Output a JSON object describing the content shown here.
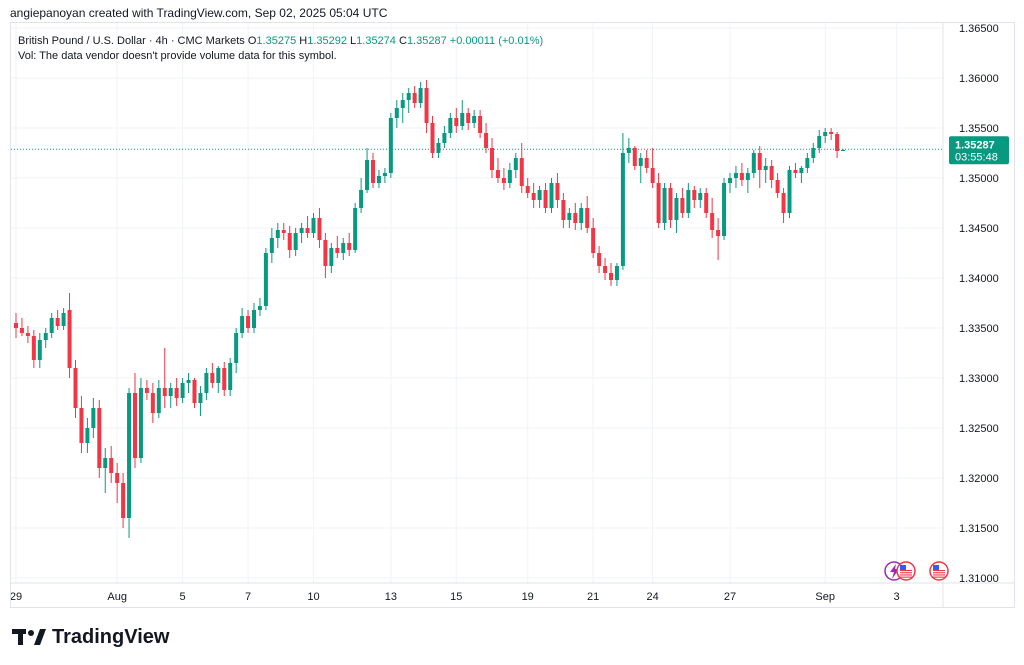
{
  "header": {
    "created_by": "angiepanoyan created with TradingView.com, Sep 02, 2025 05:04 UTC"
  },
  "legend": {
    "symbol": "British Pound / U.S. Dollar · 4h · CMC Markets",
    "o_label": "O",
    "o_value": "1.35275",
    "h_label": "H",
    "h_value": "1.35292",
    "l_label": "L",
    "l_value": "1.35274",
    "c_label": "C",
    "c_value": "1.35287",
    "change": "+0.00011 (+0.01%)",
    "volume_note": "Vol: The data vendor doesn't provide volume data for this symbol."
  },
  "price_tag": {
    "price": "1.35287",
    "countdown": "03:55:48"
  },
  "brand": {
    "name": "TradingView"
  },
  "colors": {
    "up": "#089981",
    "down": "#f23645",
    "grid": "#f0f3fa",
    "axis_text": "#131722",
    "last_line": "#089981"
  },
  "icons": [
    "lightning-icon",
    "us-flag-icon",
    "us-flag-icon"
  ],
  "chart_data": {
    "type": "candlestick",
    "y_ticks": [
      "1.31000",
      "1.31500",
      "1.32000",
      "1.32500",
      "1.33000",
      "1.33500",
      "1.34000",
      "1.34500",
      "1.35000",
      "1.35500",
      "1.36000",
      "1.36500"
    ],
    "ylim": [
      1.3095,
      1.3655
    ],
    "grid": true,
    "x_ticks": [
      {
        "label": "29",
        "index": 0
      },
      {
        "label": "Aug",
        "index": 17
      },
      {
        "label": "5",
        "index": 28
      },
      {
        "label": "7",
        "index": 39
      },
      {
        "label": "10",
        "index": 50
      },
      {
        "label": "13",
        "index": 63
      },
      {
        "label": "15",
        "index": 74
      },
      {
        "label": "19",
        "index": 86
      },
      {
        "label": "21",
        "index": 97
      },
      {
        "label": "24",
        "index": 107
      },
      {
        "label": "27",
        "index": 120
      },
      {
        "label": "Sep",
        "index": 136
      },
      {
        "label": "3",
        "index": 148
      }
    ],
    "last_price": 1.35287,
    "candles": [
      [
        1.3355,
        1.3365,
        1.334,
        1.335
      ],
      [
        1.335,
        1.336,
        1.3342,
        1.3345
      ],
      [
        1.3345,
        1.3352,
        1.3335,
        1.3342
      ],
      [
        1.3342,
        1.3348,
        1.331,
        1.3318
      ],
      [
        1.3318,
        1.3345,
        1.331,
        1.3338
      ],
      [
        1.3338,
        1.335,
        1.333,
        1.3345
      ],
      [
        1.3345,
        1.3365,
        1.334,
        1.336
      ],
      [
        1.336,
        1.3368,
        1.3348,
        1.3352
      ],
      [
        1.3352,
        1.337,
        1.3348,
        1.3365
      ],
      [
        1.3368,
        1.3385,
        1.33,
        1.331
      ],
      [
        1.331,
        1.3318,
        1.326,
        1.327
      ],
      [
        1.327,
        1.3282,
        1.3225,
        1.3235
      ],
      [
        1.3235,
        1.326,
        1.3225,
        1.325
      ],
      [
        1.325,
        1.328,
        1.324,
        1.327
      ],
      [
        1.327,
        1.3278,
        1.32,
        1.321
      ],
      [
        1.321,
        1.323,
        1.3185,
        1.322
      ],
      [
        1.322,
        1.3232,
        1.3195,
        1.3205
      ],
      [
        1.3205,
        1.3215,
        1.3175,
        1.3195
      ],
      [
        1.3195,
        1.3205,
        1.315,
        1.316
      ],
      [
        1.316,
        1.329,
        1.314,
        1.3285
      ],
      [
        1.3285,
        1.3305,
        1.321,
        1.322
      ],
      [
        1.322,
        1.33,
        1.3215,
        1.329
      ],
      [
        1.329,
        1.3298,
        1.3278,
        1.3285
      ],
      [
        1.3285,
        1.3295,
        1.3255,
        1.3265
      ],
      [
        1.3265,
        1.3298,
        1.326,
        1.329
      ],
      [
        1.329,
        1.333,
        1.327,
        1.3282
      ],
      [
        1.3282,
        1.3295,
        1.327,
        1.329
      ],
      [
        1.329,
        1.33,
        1.3272,
        1.328
      ],
      [
        1.328,
        1.33,
        1.3275,
        1.3295
      ],
      [
        1.3295,
        1.3305,
        1.3285,
        1.3298
      ],
      [
        1.3298,
        1.33,
        1.327,
        1.3275
      ],
      [
        1.3275,
        1.3292,
        1.3262,
        1.3285
      ],
      [
        1.3285,
        1.331,
        1.3278,
        1.3305
      ],
      [
        1.3305,
        1.3315,
        1.329,
        1.3295
      ],
      [
        1.3295,
        1.3312,
        1.3285,
        1.331
      ],
      [
        1.331,
        1.3316,
        1.3282,
        1.3288
      ],
      [
        1.3288,
        1.332,
        1.3282,
        1.3315
      ],
      [
        1.3315,
        1.335,
        1.3305,
        1.3345
      ],
      [
        1.3345,
        1.337,
        1.334,
        1.3362
      ],
      [
        1.3362,
        1.3368,
        1.3345,
        1.335
      ],
      [
        1.335,
        1.3375,
        1.3345,
        1.3368
      ],
      [
        1.3368,
        1.338,
        1.3362,
        1.3372
      ],
      [
        1.3372,
        1.343,
        1.3368,
        1.3425
      ],
      [
        1.3425,
        1.345,
        1.3415,
        1.344
      ],
      [
        1.344,
        1.3455,
        1.343,
        1.3448
      ],
      [
        1.3448,
        1.3455,
        1.3438,
        1.3445
      ],
      [
        1.3445,
        1.3452,
        1.342,
        1.3428
      ],
      [
        1.3428,
        1.345,
        1.3422,
        1.3445
      ],
      [
        1.3445,
        1.3455,
        1.3435,
        1.345
      ],
      [
        1.345,
        1.3462,
        1.344,
        1.3445
      ],
      [
        1.3445,
        1.3465,
        1.344,
        1.346
      ],
      [
        1.346,
        1.347,
        1.343,
        1.3438
      ],
      [
        1.3438,
        1.3445,
        1.34,
        1.3412
      ],
      [
        1.3412,
        1.3435,
        1.3405,
        1.343
      ],
      [
        1.343,
        1.3442,
        1.342,
        1.3425
      ],
      [
        1.3425,
        1.344,
        1.3418,
        1.3435
      ],
      [
        1.3435,
        1.3445,
        1.3422,
        1.3428
      ],
      [
        1.3428,
        1.3475,
        1.3425,
        1.347
      ],
      [
        1.347,
        1.35,
        1.3465,
        1.3488
      ],
      [
        1.3488,
        1.353,
        1.3485,
        1.3518
      ],
      [
        1.3518,
        1.3525,
        1.349,
        1.3495
      ],
      [
        1.3495,
        1.3508,
        1.349,
        1.3502
      ],
      [
        1.3502,
        1.351,
        1.3495,
        1.3505
      ],
      [
        1.3505,
        1.3565,
        1.35,
        1.356
      ],
      [
        1.356,
        1.3578,
        1.355,
        1.357
      ],
      [
        1.357,
        1.3585,
        1.3555,
        1.3578
      ],
      [
        1.3578,
        1.359,
        1.3565,
        1.3585
      ],
      [
        1.3585,
        1.3592,
        1.357,
        1.3575
      ],
      [
        1.3575,
        1.3596,
        1.357,
        1.359
      ],
      [
        1.359,
        1.3598,
        1.3545,
        1.3555
      ],
      [
        1.3555,
        1.3562,
        1.352,
        1.3525
      ],
      [
        1.3525,
        1.354,
        1.352,
        1.3535
      ],
      [
        1.3535,
        1.3552,
        1.353,
        1.3545
      ],
      [
        1.3545,
        1.3565,
        1.354,
        1.356
      ],
      [
        1.356,
        1.357,
        1.3545,
        1.3552
      ],
      [
        1.3552,
        1.3578,
        1.3548,
        1.3565
      ],
      [
        1.3565,
        1.357,
        1.3548,
        1.3555
      ],
      [
        1.3555,
        1.3568,
        1.355,
        1.3562
      ],
      [
        1.3562,
        1.3568,
        1.354,
        1.3545
      ],
      [
        1.3545,
        1.3555,
        1.3525,
        1.353
      ],
      [
        1.353,
        1.354,
        1.35,
        1.3508
      ],
      [
        1.3508,
        1.352,
        1.3495,
        1.35
      ],
      [
        1.35,
        1.351,
        1.3488,
        1.3495
      ],
      [
        1.3495,
        1.3515,
        1.349,
        1.3508
      ],
      [
        1.3508,
        1.3525,
        1.35,
        1.352
      ],
      [
        1.352,
        1.3535,
        1.3485,
        1.3492
      ],
      [
        1.3492,
        1.35,
        1.348,
        1.3485
      ],
      [
        1.3485,
        1.3495,
        1.347,
        1.3478
      ],
      [
        1.3478,
        1.3492,
        1.347,
        1.3488
      ],
      [
        1.3488,
        1.3495,
        1.3465,
        1.347
      ],
      [
        1.347,
        1.35,
        1.3465,
        1.3495
      ],
      [
        1.3495,
        1.3505,
        1.347,
        1.3478
      ],
      [
        1.3478,
        1.3485,
        1.345,
        1.3458
      ],
      [
        1.3458,
        1.347,
        1.345,
        1.3465
      ],
      [
        1.3465,
        1.3475,
        1.3448,
        1.3455
      ],
      [
        1.3455,
        1.3475,
        1.3448,
        1.347
      ],
      [
        1.347,
        1.3482,
        1.3445,
        1.345
      ],
      [
        1.345,
        1.346,
        1.342,
        1.3425
      ],
      [
        1.3425,
        1.3432,
        1.3405,
        1.3412
      ],
      [
        1.3412,
        1.342,
        1.3398,
        1.3405
      ],
      [
        1.3405,
        1.3415,
        1.3392,
        1.3398
      ],
      [
        1.3398,
        1.3415,
        1.3392,
        1.3412
      ],
      [
        1.3412,
        1.3545,
        1.3408,
        1.3525
      ],
      [
        1.3525,
        1.354,
        1.3515,
        1.353
      ],
      [
        1.353,
        1.3532,
        1.3508,
        1.3512
      ],
      [
        1.3512,
        1.3525,
        1.3495,
        1.352
      ],
      [
        1.352,
        1.3528,
        1.3505,
        1.351
      ],
      [
        1.351,
        1.353,
        1.349,
        1.3495
      ],
      [
        1.3495,
        1.3505,
        1.345,
        1.3455
      ],
      [
        1.3455,
        1.3495,
        1.3448,
        1.349
      ],
      [
        1.349,
        1.3495,
        1.345,
        1.3458
      ],
      [
        1.3458,
        1.3485,
        1.3445,
        1.348
      ],
      [
        1.348,
        1.349,
        1.346,
        1.3465
      ],
      [
        1.3465,
        1.3495,
        1.346,
        1.3488
      ],
      [
        1.3488,
        1.3492,
        1.347,
        1.3478
      ],
      [
        1.3478,
        1.349,
        1.347,
        1.3485
      ],
      [
        1.3485,
        1.349,
        1.346,
        1.3465
      ],
      [
        1.3465,
        1.348,
        1.344,
        1.3448
      ],
      [
        1.3448,
        1.346,
        1.3418,
        1.3442
      ],
      [
        1.3442,
        1.35,
        1.3438,
        1.3495
      ],
      [
        1.3495,
        1.3505,
        1.3485,
        1.35
      ],
      [
        1.35,
        1.3512,
        1.349,
        1.3505
      ],
      [
        1.3505,
        1.3515,
        1.3492,
        1.3498
      ],
      [
        1.3498,
        1.351,
        1.3485,
        1.3505
      ],
      [
        1.3505,
        1.3528,
        1.35,
        1.3525
      ],
      [
        1.3525,
        1.3532,
        1.349,
        1.3508
      ],
      [
        1.3508,
        1.352,
        1.3495,
        1.3512
      ],
      [
        1.3512,
        1.3518,
        1.349,
        1.3498
      ],
      [
        1.3498,
        1.3505,
        1.348,
        1.3485
      ],
      [
        1.3485,
        1.349,
        1.3455,
        1.3465
      ],
      [
        1.3465,
        1.3512,
        1.346,
        1.3508
      ],
      [
        1.3508,
        1.3515,
        1.35,
        1.3505
      ],
      [
        1.3505,
        1.3512,
        1.3495,
        1.351
      ],
      [
        1.351,
        1.3525,
        1.3505,
        1.352
      ],
      [
        1.352,
        1.3535,
        1.3515,
        1.353
      ],
      [
        1.353,
        1.3548,
        1.3525,
        1.3542
      ],
      [
        1.3542,
        1.355,
        1.3535,
        1.3546
      ],
      [
        1.3546,
        1.355,
        1.3538,
        1.3544
      ],
      [
        1.3544,
        1.3546,
        1.352,
        1.3527
      ],
      [
        1.3527,
        1.3529,
        1.3527,
        1.3528
      ]
    ]
  }
}
